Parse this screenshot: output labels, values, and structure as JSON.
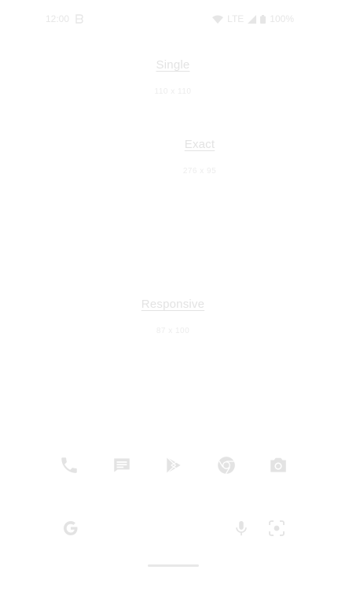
{
  "status_bar": {
    "time": "12:00",
    "notification_icon": "b-notification-icon",
    "network": "LTE",
    "battery": "100%"
  },
  "widgets": {
    "single": {
      "title": "Single",
      "size": "110 x 110"
    },
    "exact": {
      "title": "Exact",
      "size": "276 x 95"
    },
    "responsive": {
      "title": "Responsive",
      "size": "87 x 100"
    }
  },
  "dock": {
    "apps": [
      "phone-icon",
      "messages-icon",
      "play-store-icon",
      "chrome-icon",
      "camera-icon"
    ]
  },
  "search_bar": {
    "icons": [
      "google-g-icon",
      "microphone-icon",
      "lens-icon"
    ]
  },
  "colors": {
    "background": "#ffffff",
    "faded_foreground": "#e3e3e3"
  }
}
